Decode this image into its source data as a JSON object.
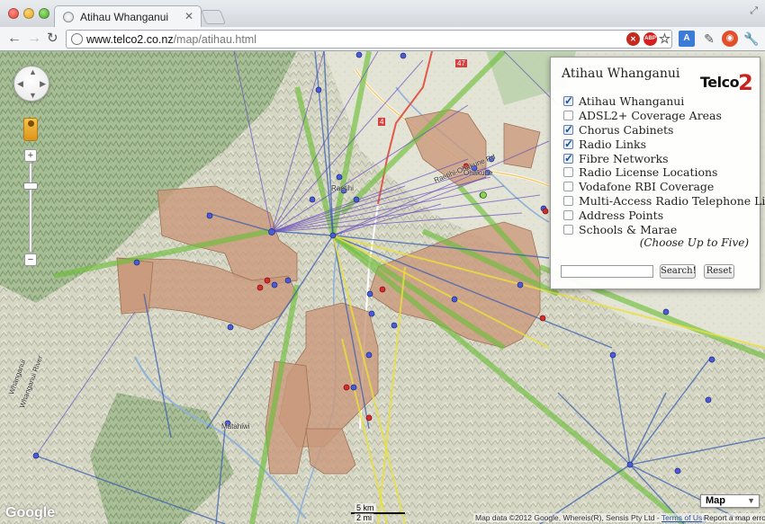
{
  "window": {
    "tab_title": "Atihau Whanganui",
    "tab_close": "✕",
    "url_host": "www.telco2.co.nz",
    "url_path": "/map/atihau.html"
  },
  "toolbar": {
    "back": "←",
    "forward": "→",
    "reload": "↻",
    "star": "☆",
    "translate": "A",
    "wrench": "🔧",
    "adblock_badge": "ABP"
  },
  "map_controls": {
    "zoom_in": "+",
    "zoom_out": "−",
    "pan_up": "▲",
    "pan_down": "▼",
    "pan_left": "◀",
    "pan_right": "▶"
  },
  "panel": {
    "title": "Atihau Whanganui",
    "logo_text": "Telco",
    "logo_num": "2",
    "layers": [
      {
        "label": "Atihau Whanganui",
        "checked": true
      },
      {
        "label": "ADSL2+ Coverage Areas",
        "checked": false
      },
      {
        "label": "Chorus Cabinets",
        "checked": true
      },
      {
        "label": "Radio Links",
        "checked": true
      },
      {
        "label": "Fibre Networks",
        "checked": true
      },
      {
        "label": "Radio License Locations",
        "checked": false
      },
      {
        "label": "Vodafone RBI Coverage",
        "checked": false
      },
      {
        "label": "Multi-Access Radio Telephone Links",
        "checked": false
      },
      {
        "label": "Address Points",
        "checked": false
      },
      {
        "label": "Schools & Marae",
        "checked": false
      }
    ],
    "choose_note": "(Choose Up to Five)",
    "search_value": "",
    "search_button": "Search!",
    "reset_button": "Reset"
  },
  "map_labels": {
    "ohakune": "Ohakune",
    "raetihi": "Raetihi",
    "matahiwi": "Matahiwi",
    "river_1": "Whanganui River",
    "river_2": "Whanganui",
    "state_hwy_1": "4",
    "state_hwy_2": "47",
    "road_1": "Raetihi-Ohakune Rd"
  },
  "bottom": {
    "google": "Google",
    "scale_km": "5 km",
    "scale_mi": "2 mi",
    "attribution_prefix": "Map data ©2012 Google, Whereis(R), Sensis Pty Ltd - ",
    "terms": "Terms of Use",
    "report": "Report a map error",
    "map_type": "Map",
    "map_type_arrow": "▼"
  },
  "colors": {
    "region_fill": "#c9987a",
    "fibre": "#6fbf3a",
    "radio_link": "#6b4fbf",
    "blue_link": "#3a5fb0",
    "yellow_link": "#e8e03a",
    "marker_blue": "#4b5bd6",
    "marker_red": "#d62d2d"
  }
}
